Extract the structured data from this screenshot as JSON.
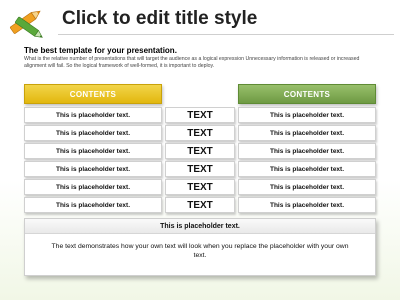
{
  "slide": {
    "title": "Click to edit title style",
    "subtitle": "The best template for your presentation.",
    "description": "What is the relative number of presentations that will target the audience as a logical expression Unnecessary information is released or increased alignment will fail. So the logical framework of well-formed, it is important to deploy."
  },
  "table": {
    "left_header": "CONTENTS",
    "right_header": "CONTENTS",
    "rows": [
      {
        "left": "This is placeholder text.",
        "middle": "TEXT",
        "right": "This is placeholder text."
      },
      {
        "left": "This is placeholder text.",
        "middle": "TEXT",
        "right": "This is placeholder text."
      },
      {
        "left": "This is placeholder text.",
        "middle": "TEXT",
        "right": "This is placeholder text."
      },
      {
        "left": "This is placeholder text.",
        "middle": "TEXT",
        "right": "This is placeholder text."
      },
      {
        "left": "This is placeholder text.",
        "middle": "TEXT",
        "right": "This is placeholder text."
      },
      {
        "left": "This is placeholder text.",
        "middle": "TEXT",
        "right": "This is placeholder text."
      }
    ]
  },
  "bottom_box": {
    "heading": "This is placeholder text.",
    "body": "The text demonstrates how your own text will look when you replace the placeholder with your own text."
  },
  "colors": {
    "left_header": "#e2b70e",
    "right_header": "#6e9a43"
  },
  "icons": [
    "crayons-logo-icon"
  ]
}
